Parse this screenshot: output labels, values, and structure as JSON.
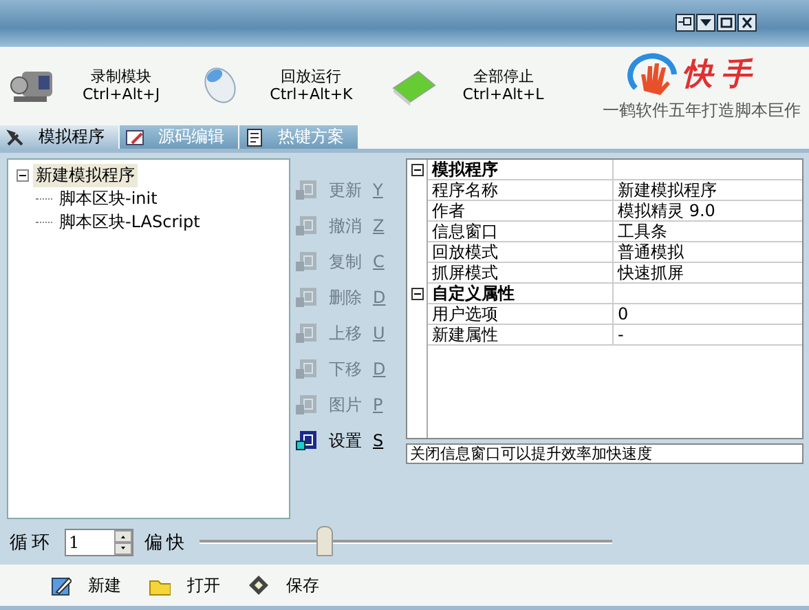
{
  "toolbar": [
    {
      "kind": "camera",
      "label": "录制模块",
      "shortcut": "Ctrl+Alt+J"
    },
    {
      "kind": "mouse",
      "label": "回放运行",
      "shortcut": "Ctrl+Alt+K"
    },
    {
      "kind": "board",
      "label": "全部停止",
      "shortcut": "Ctrl+Alt+L"
    }
  ],
  "logo": {
    "name": "快手",
    "tagline": "一鹤软件五年打造脚本巨作"
  },
  "tabs": [
    {
      "kind": "tools",
      "label": "模拟程序",
      "selected": true
    },
    {
      "kind": "edit",
      "label": "源码编辑",
      "selected": false
    },
    {
      "kind": "keys",
      "label": "热键方案",
      "selected": false
    }
  ],
  "tree": {
    "label": "新建模拟程序",
    "expanded": true,
    "selected": true,
    "children": [
      {
        "label": "脚本区块-init"
      },
      {
        "label": "脚本区块-LAScript"
      }
    ]
  },
  "actions": [
    {
      "label": "更新",
      "key": "Y",
      "disabled": true
    },
    {
      "label": "撤消",
      "key": "Z",
      "disabled": true
    },
    {
      "label": "复制",
      "key": "C",
      "disabled": true
    },
    {
      "label": "删除",
      "key": "D",
      "disabled": true
    },
    {
      "label": "上移",
      "key": "U",
      "disabled": true
    },
    {
      "label": "下移",
      "key": "D",
      "disabled": true
    },
    {
      "label": "图片",
      "key": "P",
      "disabled": true
    },
    {
      "label": "设置",
      "key": "S",
      "disabled": false
    }
  ],
  "properties": [
    {
      "category": "模拟程序",
      "expanded": true,
      "rows": [
        {
          "name": "程序名称",
          "value": "新建模拟程序"
        },
        {
          "name": "作者",
          "value": "模拟精灵 9.0"
        },
        {
          "name": "信息窗口",
          "value": "工具条"
        },
        {
          "name": "回放模式",
          "value": "普通模拟"
        },
        {
          "name": "抓屏模式",
          "value": "快速抓屏"
        }
      ]
    },
    {
      "category": "自定义属性",
      "expanded": true,
      "rows": [
        {
          "name": "用户选项",
          "value": "0"
        },
        {
          "name": "新建属性",
          "value": "-"
        }
      ]
    }
  ],
  "info": "关闭信息窗口可以提升效率加快速度",
  "loop": {
    "label": "循环",
    "value": "1"
  },
  "speed": {
    "label": "偏快",
    "level": 0.3
  },
  "bottom_buttons": [
    {
      "kind": "new",
      "label": "新建"
    },
    {
      "kind": "open",
      "label": "打开"
    },
    {
      "kind": "save",
      "label": "保存"
    }
  ]
}
